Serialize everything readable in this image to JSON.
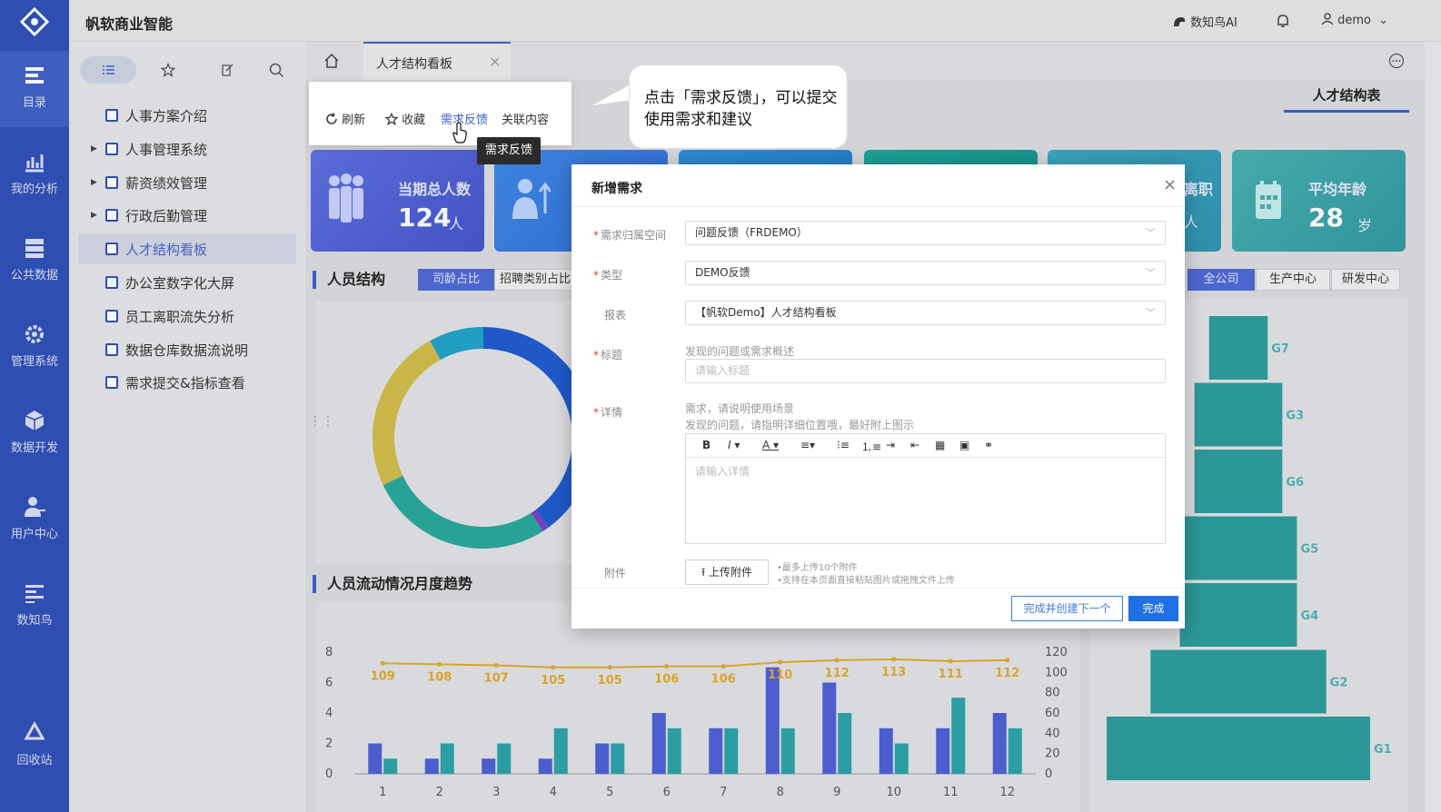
{
  "app": {
    "brand": "帆软商业智能",
    "ai_label": "数知鸟AI",
    "user": "demo"
  },
  "leftnav": [
    {
      "label": "目录",
      "icon": "catalog-icon"
    },
    {
      "label": "我的分析",
      "icon": "analysis-icon"
    },
    {
      "label": "公共数据",
      "icon": "data-icon"
    },
    {
      "label": "管理系统",
      "icon": "gear-icon"
    },
    {
      "label": "数据开发",
      "icon": "cube-icon"
    },
    {
      "label": "用户中心",
      "icon": "user-icon"
    },
    {
      "label": "数知鸟",
      "icon": "list-icon"
    },
    {
      "label": "回收站",
      "icon": "recycle-icon"
    }
  ],
  "tree": [
    {
      "label": "人事方案介绍",
      "expand": false
    },
    {
      "label": "人事管理系统",
      "expand": true
    },
    {
      "label": "薪资绩效管理",
      "expand": true
    },
    {
      "label": "行政后勤管理",
      "expand": true
    },
    {
      "label": "人才结构看板",
      "expand": false,
      "active": true
    },
    {
      "label": "办公室数字化大屏",
      "expand": false
    },
    {
      "label": "员工离职流失分析",
      "expand": false
    },
    {
      "label": "数据仓库数据流说明",
      "expand": false
    },
    {
      "label": "需求提交&指标查看",
      "expand": false
    }
  ],
  "tabs": {
    "active": "人才结构看板"
  },
  "dashboard": {
    "subtab": "人才结构表",
    "kpi_total_label": "当期总人数",
    "kpi_total_value": "124",
    "kpi_total_unit": "人",
    "kpi_resign_label": "离职",
    "kpi_resign_unit": "人",
    "kpi_age_label": "平均年龄",
    "kpi_age_value": "28",
    "kpi_age_unit": "岁",
    "section1": "人员结构",
    "seg1": [
      "司龄占比",
      "招聘类别占比"
    ],
    "seg2": [
      "全公司",
      "生产中心",
      "研发中心"
    ],
    "section2": "人员流动情况月度趋势"
  },
  "actionbar": {
    "refresh": "刷新",
    "favorite": "收藏",
    "feedback": "需求反馈",
    "related": "关联内容"
  },
  "tooltip": "需求反馈",
  "callout": "点击「需求反馈」，可以提交使用需求和建议",
  "modal": {
    "title": "新增需求",
    "f_space_label": "需求归属空间",
    "f_space_value": "问题反馈（FRDEMO）",
    "f_type_label": "类型",
    "f_type_value": "DEMO反馈",
    "f_report_label": "报表",
    "f_report_value": "【帆软Demo】人才结构看板",
    "f_title_label": "标题",
    "f_title_hint": "发现的问题或需求概述",
    "f_title_placeholder": "请输入标题",
    "f_detail_label": "详情",
    "f_detail_hint1": "需求，请说明使用场景",
    "f_detail_hint2": "发现的问题，请指明详细位置哦，最好附上图示",
    "f_detail_placeholder": "请输入详情",
    "f_attach_label": "附件",
    "upload_btn": "上传附件",
    "upload_hint1": "•最多上传10个附件",
    "upload_hint2": "•支持在本页面直接粘贴图片或拖拽文件上传",
    "btn_next": "完成并创建下一个",
    "btn_done": "完成"
  },
  "chart_data": [
    {
      "type": "pie",
      "title": "人员结构",
      "note": "donut chart, partially occluded by dialog",
      "slices": [
        {
          "value": 40,
          "color": "#1d5bd1"
        },
        {
          "value": 1,
          "color": "#7b3fc4"
        },
        {
          "value": 27,
          "color": "#28a89c"
        },
        {
          "value": 24,
          "color": "#d3bd4a"
        },
        {
          "value": 8,
          "color": "#1ea3c8"
        }
      ]
    },
    {
      "type": "bar",
      "title": "人员流动情况月度趋势",
      "categories": [
        "1",
        "2",
        "3",
        "4",
        "5",
        "6",
        "7",
        "8",
        "9",
        "10",
        "11",
        "12"
      ],
      "series": [
        {
          "values": [
            2,
            1,
            1,
            1,
            2,
            4,
            3,
            7,
            6,
            3,
            3,
            4
          ],
          "color": "#4d5fd6"
        },
        {
          "values": [
            1,
            2,
            2,
            3,
            2,
            3,
            3,
            3,
            4,
            2,
            5,
            3
          ],
          "color": "#2ba3a8"
        },
        {
          "type": "line",
          "axis": "right",
          "values": [
            109,
            108,
            107,
            105,
            105,
            106,
            106,
            110,
            112,
            113,
            111,
            112
          ],
          "color": "#e1a92a"
        }
      ],
      "ylim": [
        0,
        8
      ],
      "yticks": [
        "0",
        "2",
        "4",
        "6",
        "8"
      ],
      "y2lim": [
        0,
        120
      ],
      "y2ticks": [
        "0",
        "20",
        "40",
        "60",
        "80",
        "100",
        "120"
      ]
    },
    {
      "type": "bar",
      "orientation": "horizontal-pyramid",
      "categories": [
        "G7",
        "G3",
        "G6",
        "G5",
        "G4",
        "G2",
        "G1"
      ],
      "values": [
        2,
        3,
        3,
        4,
        4,
        6,
        9
      ],
      "color": "#2a9d9c"
    }
  ]
}
